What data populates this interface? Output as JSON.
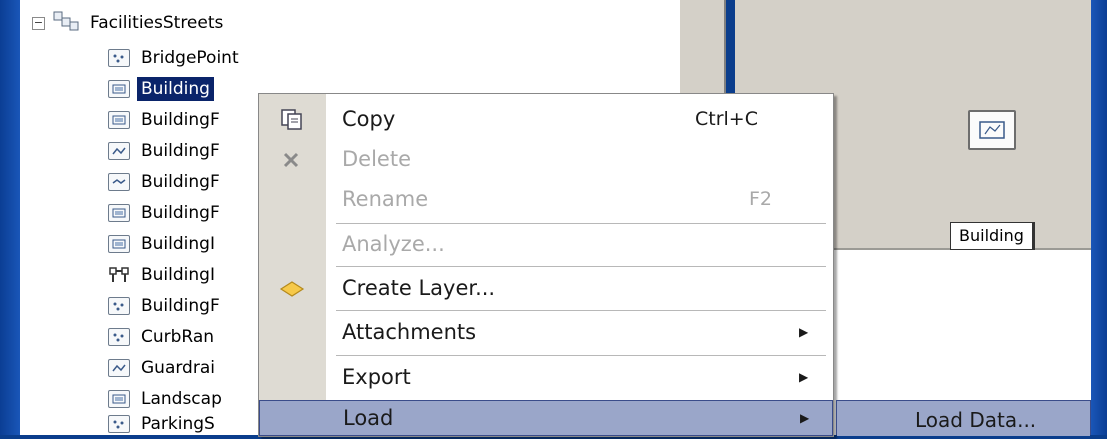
{
  "tree": {
    "group_label": "FacilitiesStreets",
    "expander": "−",
    "items": [
      {
        "label": "BridgePoint",
        "icon": "point-feature-class-icon",
        "selected": false
      },
      {
        "label": "Building",
        "icon": "polygon-feature-class-icon",
        "selected": true
      },
      {
        "label": "BuildingF",
        "icon": "polygon-feature-class-icon",
        "selected": false
      },
      {
        "label": "BuildingF",
        "icon": "line-feature-class-icon",
        "selected": false
      },
      {
        "label": "BuildingF",
        "icon": "line-feature-class-icon",
        "selected": false
      },
      {
        "label": "BuildingF",
        "icon": "polygon-feature-class-icon",
        "selected": false
      },
      {
        "label": "BuildingI",
        "icon": "polygon-feature-class-icon",
        "selected": false
      },
      {
        "label": "BuildingI",
        "icon": "relationship-class-icon",
        "selected": false
      },
      {
        "label": "BuildingF",
        "icon": "point-feature-class-icon",
        "selected": false
      },
      {
        "label": "CurbRan",
        "icon": "point-feature-class-icon",
        "selected": false
      },
      {
        "label": "Guardrai",
        "icon": "line-feature-class-icon",
        "selected": false
      },
      {
        "label": "Landscap",
        "icon": "polygon-feature-class-icon",
        "selected": false
      },
      {
        "label": "ParkingS",
        "icon": "point-feature-class-icon",
        "selected": false
      }
    ]
  },
  "preview": {
    "label": "Building",
    "icon": "polygon-feature-class-icon"
  },
  "context_menu": {
    "items": [
      {
        "label": "Copy",
        "shortcut": "Ctrl+C",
        "icon": "copy-icon",
        "disabled": false
      },
      {
        "label": "Delete",
        "shortcut": "",
        "icon": "delete-icon",
        "disabled": true
      },
      {
        "label": "Rename",
        "shortcut": "F2",
        "icon": "",
        "disabled": true
      },
      {
        "label": "Analyze...",
        "shortcut": "",
        "icon": "",
        "disabled": true
      },
      {
        "label": "Create Layer...",
        "shortcut": "",
        "icon": "create-layer-icon",
        "disabled": false
      },
      {
        "label": "Attachments",
        "shortcut": "",
        "icon": "",
        "disabled": false,
        "submenu": true
      },
      {
        "label": "Export",
        "shortcut": "",
        "icon": "",
        "disabled": false,
        "submenu": true
      },
      {
        "label": "Load",
        "shortcut": "",
        "icon": "",
        "disabled": false,
        "submenu": true,
        "highlighted": true
      }
    ],
    "submenu_arrow": "▶"
  },
  "submenu": {
    "items": [
      {
        "label": "Load Data...",
        "highlighted": true
      }
    ]
  },
  "colors": {
    "selection": "#0a246a",
    "menu_highlight": "#9aa6c9",
    "frame": "#0a3d8c",
    "panel_gray": "#d4d0c8"
  }
}
